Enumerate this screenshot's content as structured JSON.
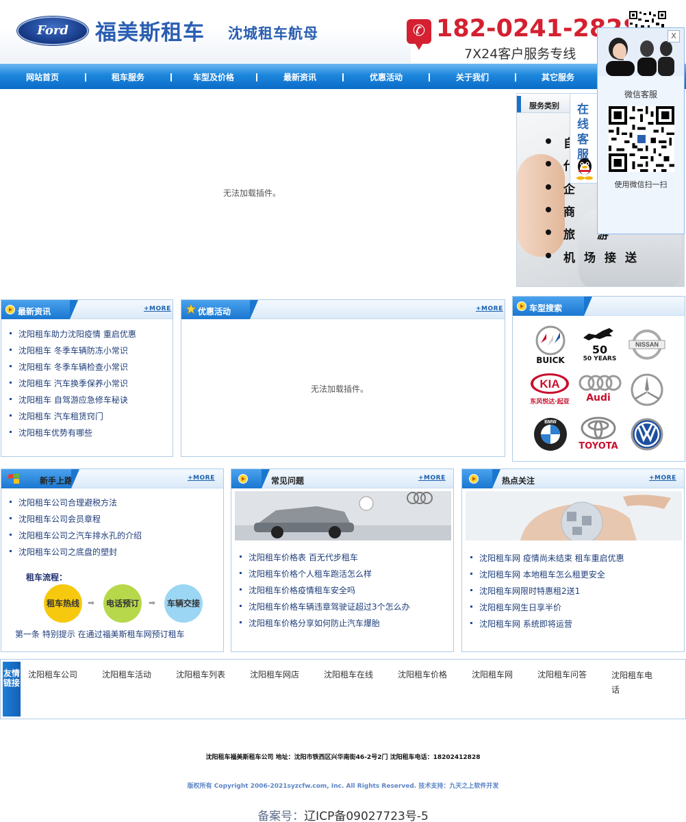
{
  "header": {
    "logo_text": "Ford",
    "brand_name": "福美斯租车",
    "slogan": "沈城租车航母",
    "phone_number": "182-0241-2828",
    "service_line": "7X24客户服务专线"
  },
  "nav": {
    "items": [
      "网站首页",
      "租车服务",
      "车型及价格",
      "最新资讯",
      "优惠活动",
      "关于我们",
      "其它服务"
    ]
  },
  "banner": {
    "plugin_message": "无法加载插件。"
  },
  "services": {
    "tab_label": "服务类别",
    "items": [
      "自",
      "代",
      "企 业",
      "商 务",
      "旅 游",
      "机场接送"
    ]
  },
  "online_service": {
    "label": "在线客服"
  },
  "wechat_popup": {
    "close_label": "X",
    "title": "微信客服",
    "hint": "使用微信扫一扫"
  },
  "latest_news": {
    "title": "最新资讯",
    "more": "+MORE",
    "items": [
      "沈阳租车助力沈阳疫情  重启优惠",
      "沈阳租车  冬季车辆防冻小常识",
      "沈阳租车  冬季车辆检查小常识",
      "沈阳租车  汽车换季保养小常识",
      "沈阳租车  自驾游应急修车秘诀",
      "沈阳租车  汽车租赁窍门",
      "沈阳租车优势有哪些"
    ]
  },
  "promotions": {
    "title": "优惠活动",
    "more": "+MORE",
    "plugin_message": "无法加载插件。"
  },
  "car_search": {
    "title": "车型搜索",
    "brands": [
      "BUICK",
      "50 YEARS",
      "NISSAN",
      "东风悦达·起亚",
      "Audi",
      "Mercedes",
      "BMW",
      "TOYOTA",
      "VW"
    ]
  },
  "newbie": {
    "title": "新手上路",
    "more": "+MORE",
    "items": [
      "沈阳租车公司合理避税方法",
      "沈阳租车公司会员章程",
      "沈阳租车公司之汽车排水孔的介绍",
      "沈阳租车公司之底盘的塑封"
    ],
    "process_title": "租车流程：",
    "process_steps": [
      "租车热线",
      "电话预订",
      "车辆交接"
    ],
    "footnote": "第一条  特别提示  在通过福美斯租车网预订租车"
  },
  "faq": {
    "title": "常见问题",
    "more": "+MORE",
    "items": [
      "沈阳租车价格表  百无代步租车",
      "沈阳租车价格个人租车跑活怎么样",
      "沈阳租车价格疫情租车安全吗",
      "沈阳租车价格车辆违章驾驶证超过3个怎么办",
      "沈阳租车价格分享如何防止汽车爆胎"
    ]
  },
  "hot": {
    "title": "热点关注",
    "more": "+MORE",
    "items": [
      "沈阳租车网  疫情尚未结束  租车重启优惠",
      "沈阳租车网  本地租车怎么租更安全",
      "沈阳租车网限时特惠租2送1",
      "沈阳租车网生日享半价",
      "沈阳租车网  系统即将运营"
    ]
  },
  "friend_links": {
    "tag": "友情链接",
    "items": [
      "沈阳租车公司",
      "沈阳租车活动",
      "沈阳租车列表",
      "沈阳租车网店",
      "沈阳租车在线",
      "沈阳租车价格",
      "沈阳租车网",
      "沈阳租车问答",
      "沈阳租车电话"
    ]
  },
  "footer": {
    "company_line": "沈阳租车福美斯租车公司   地址：沈阳市铁西区兴华南街46-2号2门     沈阳租车电话：18202412828",
    "copyright": "版权所有 Copyright 2006-2021syzcfw.com, Inc. All Rights Reserved. 技术支持：九天之上软件开发",
    "icp_label": "备案号：",
    "icp_number": "辽ICP备09027723号-5"
  },
  "colors": {
    "brand_blue": "#2a5eb2",
    "nav_blue": "#1d86dc",
    "phone_red": "#d42030",
    "link_navy": "#1e3d7a"
  }
}
